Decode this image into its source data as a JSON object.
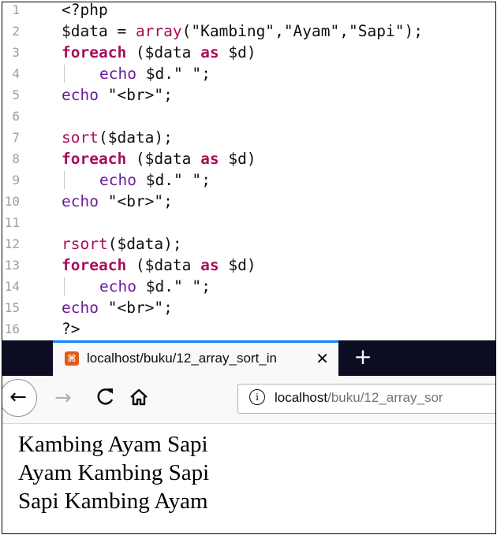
{
  "editor": {
    "lines": [
      {
        "n": "1",
        "parts": [
          [
            "tag",
            "<?php"
          ]
        ]
      },
      {
        "n": "2",
        "parts": [
          [
            "var",
            "$data"
          ],
          [
            "op",
            " = "
          ],
          [
            "fn",
            "array"
          ],
          [
            "op",
            "("
          ],
          [
            "str",
            "\"Kambing\""
          ],
          [
            "op",
            ","
          ],
          [
            "str",
            "\"Ayam\""
          ],
          [
            "op",
            ","
          ],
          [
            "str",
            "\"Sapi\""
          ],
          [
            "op",
            ");"
          ]
        ]
      },
      {
        "n": "3",
        "parts": [
          [
            "kw",
            "foreach"
          ],
          [
            "op",
            " ("
          ],
          [
            "var",
            "$data"
          ],
          [
            "op",
            " "
          ],
          [
            "kw",
            "as"
          ],
          [
            "op",
            " "
          ],
          [
            "var",
            "$d"
          ],
          [
            "op",
            ")"
          ]
        ]
      },
      {
        "n": "4",
        "indent": true,
        "parts": [
          [
            "echo",
            "echo"
          ],
          [
            "op",
            " "
          ],
          [
            "var",
            "$d"
          ],
          [
            "op",
            "."
          ],
          [
            "str",
            "\" \""
          ],
          [
            "op",
            ";"
          ]
        ]
      },
      {
        "n": "5",
        "parts": [
          [
            "echo",
            "echo"
          ],
          [
            "op",
            " "
          ],
          [
            "str",
            "\"<br>\""
          ],
          [
            "op",
            ";"
          ]
        ]
      },
      {
        "n": "6",
        "parts": []
      },
      {
        "n": "7",
        "parts": [
          [
            "fn",
            "sort"
          ],
          [
            "op",
            "("
          ],
          [
            "var",
            "$data"
          ],
          [
            "op",
            ");"
          ]
        ]
      },
      {
        "n": "8",
        "parts": [
          [
            "kw",
            "foreach"
          ],
          [
            "op",
            " ("
          ],
          [
            "var",
            "$data"
          ],
          [
            "op",
            " "
          ],
          [
            "kw",
            "as"
          ],
          [
            "op",
            " "
          ],
          [
            "var",
            "$d"
          ],
          [
            "op",
            ")"
          ]
        ]
      },
      {
        "n": "9",
        "indent": true,
        "parts": [
          [
            "echo",
            "echo"
          ],
          [
            "op",
            " "
          ],
          [
            "var",
            "$d"
          ],
          [
            "op",
            "."
          ],
          [
            "str",
            "\" \""
          ],
          [
            "op",
            ";"
          ]
        ]
      },
      {
        "n": "10",
        "parts": [
          [
            "echo",
            "echo"
          ],
          [
            "op",
            " "
          ],
          [
            "str",
            "\"<br>\""
          ],
          [
            "op",
            ";"
          ]
        ]
      },
      {
        "n": "11",
        "parts": []
      },
      {
        "n": "12",
        "parts": [
          [
            "fn",
            "rsort"
          ],
          [
            "op",
            "("
          ],
          [
            "var",
            "$data"
          ],
          [
            "op",
            ");"
          ]
        ]
      },
      {
        "n": "13",
        "parts": [
          [
            "kw",
            "foreach"
          ],
          [
            "op",
            " ("
          ],
          [
            "var",
            "$data"
          ],
          [
            "op",
            " "
          ],
          [
            "kw",
            "as"
          ],
          [
            "op",
            " "
          ],
          [
            "var",
            "$d"
          ],
          [
            "op",
            ")"
          ]
        ]
      },
      {
        "n": "14",
        "indent": true,
        "parts": [
          [
            "echo",
            "echo"
          ],
          [
            "op",
            " "
          ],
          [
            "var",
            "$d"
          ],
          [
            "op",
            "."
          ],
          [
            "str",
            "\" \""
          ],
          [
            "op",
            ";"
          ]
        ]
      },
      {
        "n": "15",
        "parts": [
          [
            "echo",
            "echo"
          ],
          [
            "op",
            " "
          ],
          [
            "str",
            "\"<br>\""
          ],
          [
            "op",
            ";"
          ]
        ]
      },
      {
        "n": "16",
        "parts": [
          [
            "tag",
            "?>"
          ]
        ]
      }
    ]
  },
  "browser": {
    "tab": {
      "title": "localhost/buku/12_array_sort_in",
      "close": "✕",
      "favicon": "xampp-icon"
    },
    "new_tab": "+",
    "nav": {
      "back": "←",
      "forward": "→",
      "reload": "C",
      "info": "i"
    },
    "url": {
      "host": "localhost",
      "path": "/buku/12_array_sor"
    },
    "colors": {
      "tab_accent": "#0a84ff",
      "tabbar_bg": "#0c0c22",
      "keyword": "#a90d5b"
    }
  },
  "page": {
    "output_lines": [
      "Kambing Ayam Sapi",
      "Ayam Kambing Sapi",
      "Sapi Kambing Ayam"
    ]
  }
}
